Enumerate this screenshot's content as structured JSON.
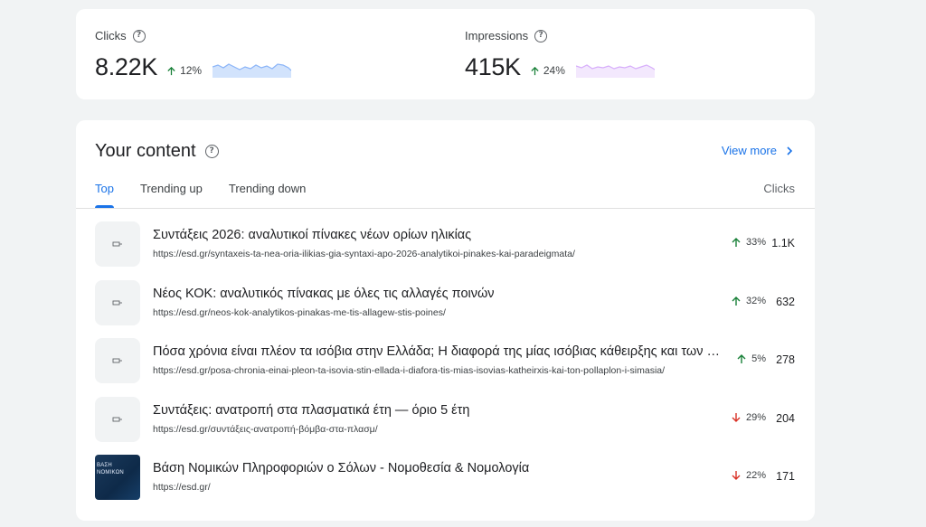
{
  "metrics": {
    "clicks": {
      "label": "Clicks",
      "value": "8.22K",
      "delta": "12%",
      "direction": "up",
      "color": "#8ab4f8"
    },
    "impressions": {
      "label": "Impressions",
      "value": "415K",
      "delta": "24%",
      "direction": "up",
      "color": "#d7aefb"
    }
  },
  "content": {
    "title": "Your content",
    "view_more": "View more",
    "tabs": [
      {
        "label": "Top",
        "active": true
      },
      {
        "label": "Trending up",
        "active": false
      },
      {
        "label": "Trending down",
        "active": false
      }
    ],
    "clicks_column": "Clicks",
    "rows": [
      {
        "title": "Συντάξεις 2026: αναλυτικοί πίνακες νέων ορίων ηλικίας",
        "url": "https://esd.gr/syntaxeis-ta-nea-oria-ilikias-gia-syntaxi-apo-2026-analytikoi-pinakes-kai-paradeigmata/",
        "delta": "33%",
        "direction": "up",
        "clicks": "1.1K",
        "thumb": "placeholder"
      },
      {
        "title": "Νέος ΚΟΚ: αναλυτικός πίνακας με όλες τις αλλαγές ποινών",
        "url": "https://esd.gr/neos-kok-analytikos-pinakas-me-tis-allagew-stis-poines/",
        "delta": "32%",
        "direction": "up",
        "clicks": "632",
        "thumb": "placeholder"
      },
      {
        "title": "Πόσα χρόνια είναι πλέον τα ισόβια στην Ελλάδα; Η διαφορά της μίας ισόβιας κάθειρξης και των πολλαπλών",
        "url": "https://esd.gr/posa-chronia-einai-pleon-ta-isovia-stin-ellada-i-diafora-tis-mias-isovias-katheirxis-kai-ton-pollaplon-i-simasia/",
        "delta": "5%",
        "direction": "up",
        "clicks": "278",
        "thumb": "placeholder"
      },
      {
        "title": "Συντάξεις: ανατροπή στα πλασματικά έτη — όριο 5 έτη",
        "url": "https://esd.gr/συντάξεις-ανατροπή-βόμβα-στα-πλασμ/",
        "delta": "29%",
        "direction": "down",
        "clicks": "204",
        "thumb": "placeholder"
      },
      {
        "title": "Βάση Νομικών Πληροφοριών ο Σόλων - Νομοθεσία & Νομολογία",
        "url": "https://esd.gr/",
        "delta": "22%",
        "direction": "down",
        "clicks": "171",
        "thumb": "image",
        "thumb_text": [
          "ΒΑΣΗ",
          "ΝΟΜΙΚΩΝ"
        ]
      }
    ]
  },
  "colors": {
    "accent": "#1a73e8",
    "up": "#188038",
    "down": "#d93025"
  }
}
